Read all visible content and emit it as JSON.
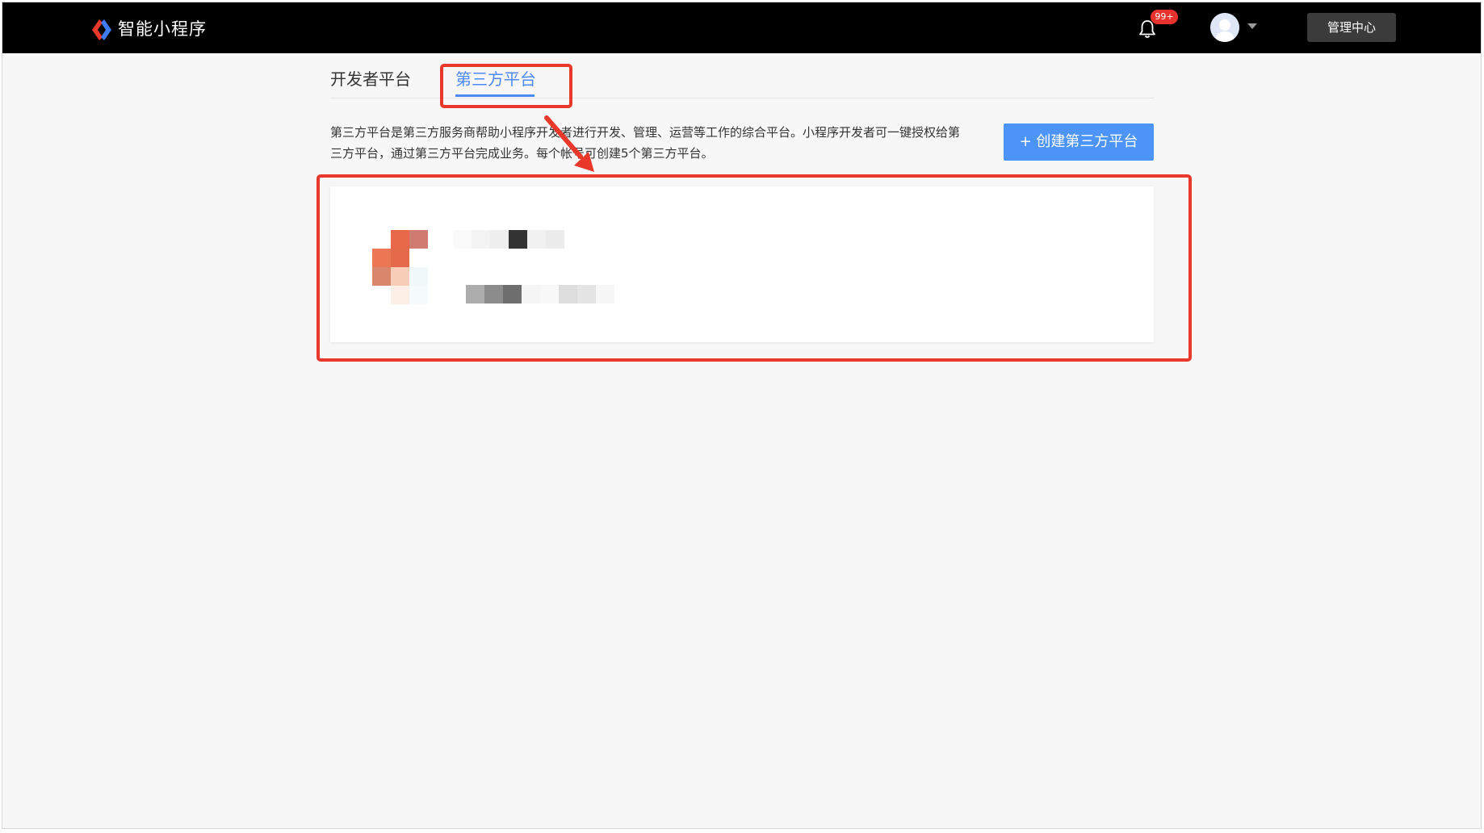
{
  "header": {
    "brand": "智能小程序",
    "notification_badge": "99+",
    "admin_button": "管理中心"
  },
  "tabs": [
    {
      "label": "开发者平台",
      "active": false
    },
    {
      "label": "第三方平台",
      "active": true
    }
  ],
  "description": "第三方平台是第三方服务商帮助小程序开发者进行开发、管理、运营等工作的综合平台。小程序开发者可一键授权给第三方平台，通过第三方平台完成业务。每个帐号可创建5个第三方平台。",
  "create_button": "+ 创建第三方平台",
  "colors": {
    "header_bg": "#000000",
    "accent": "#4c8af5",
    "button": "#4c94f5",
    "annotation": "#e8392b",
    "badge": "#e8322d"
  },
  "icons": {
    "logo": "brand-logo-icon",
    "bell": "bell-icon",
    "avatar": "avatar-icon",
    "caret": "caret-down-icon"
  }
}
